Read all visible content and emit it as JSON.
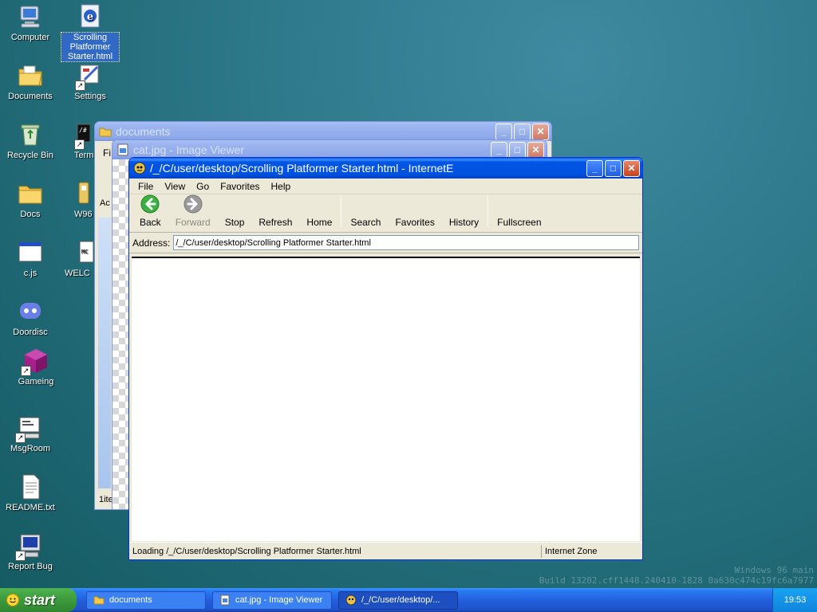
{
  "desktop": {
    "icons": [
      {
        "label": "Computer",
        "icon": "computer-icon"
      },
      {
        "label": "Scrolling Platformer Starter.html",
        "icon": "ie-document-icon"
      },
      {
        "label": "Documents",
        "icon": "documents-folder-icon"
      },
      {
        "label": "Settings",
        "icon": "settings-icon"
      },
      {
        "label": "Recycle Bin",
        "icon": "recycle-bin-icon"
      },
      {
        "label": "Term",
        "icon": "terminal-icon"
      },
      {
        "label": "Docs",
        "icon": "folder-icon"
      },
      {
        "label": "W96",
        "icon": "w96-icon"
      },
      {
        "label": "c.js",
        "icon": "script-window-icon"
      },
      {
        "label": "WELC",
        "icon": "welcome-icon"
      },
      {
        "label": "Doordisc",
        "icon": "discord-icon"
      },
      {
        "label": "Gameing",
        "icon": "cube-icon"
      },
      {
        "label": "MsgRoom",
        "icon": "msgroom-icon"
      },
      {
        "label": "README.txt",
        "icon": "text-file-icon"
      },
      {
        "label": "Report Bug",
        "icon": "report-bug-icon"
      }
    ]
  },
  "windows": {
    "documents": {
      "title": "documents",
      "menu_partial": "Fi",
      "status_partial": "1ite",
      "row_partial": "Ac"
    },
    "image_viewer": {
      "title": "cat.jpg - Image Viewer"
    },
    "browser": {
      "title": "/_/C/user/desktop/Scrolling Platformer Starter.html - InternetE",
      "menu": [
        "File",
        "View",
        "Go",
        "Favorites",
        "Help"
      ],
      "toolbar": {
        "back": "Back",
        "forward": "Forward",
        "stop": "Stop",
        "refresh": "Refresh",
        "home": "Home",
        "search": "Search",
        "favorites": "Favorites",
        "history": "History",
        "fullscreen": "Fullscreen"
      },
      "address_label": "Address:",
      "address_value": "/_/C/user/desktop/Scrolling Platformer Starter.html",
      "status_text": "Loading /_/C/user/desktop/Scrolling Platformer Starter.html",
      "zone": "Internet Zone"
    }
  },
  "taskbar": {
    "start_label": "start",
    "tasks": [
      {
        "label": "documents"
      },
      {
        "label": "cat.jpg - Image Viewer"
      },
      {
        "label": "/_/C/user/desktop/..."
      }
    ],
    "clock": "19:53"
  },
  "watermark": {
    "line1": "Windows 96 main",
    "line2": "Build 13202.cff1448.240410-1828 0a630c474c19fc6a7977"
  },
  "colors": {
    "title_active": "#0055e5",
    "title_inactive": "#8fa9ea",
    "taskbar": "#245edc",
    "start": "#3c9a3c",
    "tray": "#0f84dd"
  }
}
